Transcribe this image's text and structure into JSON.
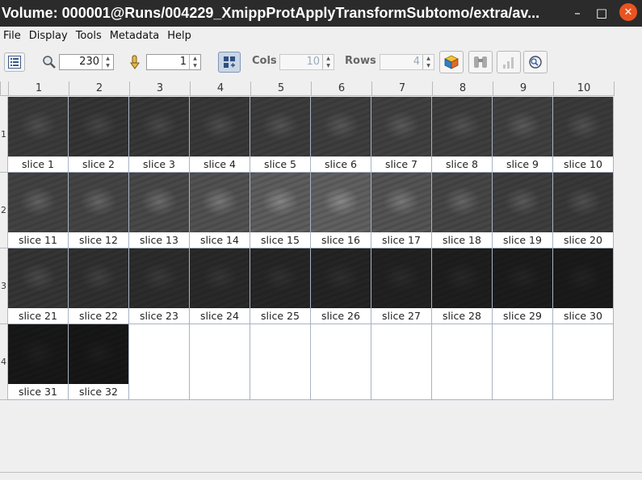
{
  "window": {
    "title": "Volume: 000001@Runs/004229_XmippProtApplyTransformSubtomo/extra/av...",
    "controls": {
      "minimize": "–",
      "maximize": "□",
      "close": "✕"
    }
  },
  "menu": [
    "File",
    "Display",
    "Tools",
    "Metadata",
    "Help"
  ],
  "toolbar": {
    "zoom_value": "230",
    "goto_value": "1",
    "cols_label": "Cols",
    "cols_value": "10",
    "rows_label": "Rows",
    "rows_value": "4",
    "icons": [
      "list-view-icon",
      "zoom-icon",
      "goto-icon",
      "grid-toggle-icon",
      "volume-3d-icon",
      "binoculars-icon",
      "histogram-icon",
      "search-icon"
    ]
  },
  "grid": {
    "column_headers": [
      "1",
      "2",
      "3",
      "4",
      "5",
      "6",
      "7",
      "8",
      "9",
      "10"
    ],
    "row_headers": [
      "1",
      "2",
      "3",
      "4"
    ],
    "slices": [
      {
        "label": "slice 1",
        "shade": "#7a7a7a",
        "hi": "#a6a6a6"
      },
      {
        "label": "slice 2",
        "shade": "#747474",
        "hi": "#9c9c9c"
      },
      {
        "label": "slice 3",
        "shade": "#767676",
        "hi": "#9e9e9e"
      },
      {
        "label": "slice 4",
        "shade": "#787878",
        "hi": "#a4a4a4"
      },
      {
        "label": "slice 5",
        "shade": "#7c7c7c",
        "hi": "#acacac"
      },
      {
        "label": "slice 6",
        "shade": "#7e7e7e",
        "hi": "#b0b0b0"
      },
      {
        "label": "slice 7",
        "shade": "#808080",
        "hi": "#b2b2b2"
      },
      {
        "label": "slice 8",
        "shade": "#7e7e7e",
        "hi": "#a8a8a8"
      },
      {
        "label": "slice 9",
        "shade": "#808080",
        "hi": "#b4b4b4"
      },
      {
        "label": "slice 10",
        "shade": "#7a7a7a",
        "hi": "#aaaaaa"
      },
      {
        "label": "slice 11",
        "shade": "#828282",
        "hi": "#c0c0c0"
      },
      {
        "label": "slice 12",
        "shade": "#848484",
        "hi": "#c4c4c4"
      },
      {
        "label": "slice 13",
        "shade": "#888888",
        "hi": "#cacaca"
      },
      {
        "label": "slice 14",
        "shade": "#909090",
        "hi": "#d4d4d4"
      },
      {
        "label": "slice 15",
        "shade": "#9a9a9a",
        "hi": "#dcdcdc"
      },
      {
        "label": "slice 16",
        "shade": "#9c9c9c",
        "hi": "#e0e0e0"
      },
      {
        "label": "slice 17",
        "shade": "#929292",
        "hi": "#d2d2d2"
      },
      {
        "label": "slice 18",
        "shade": "#868686",
        "hi": "#c2c2c2"
      },
      {
        "label": "slice 19",
        "shade": "#7e7e7e",
        "hi": "#b6b6b6"
      },
      {
        "label": "slice 20",
        "shade": "#787878",
        "hi": "#acacac"
      },
      {
        "label": "slice 21",
        "shade": "#747474",
        "hi": "#a2a2a2"
      },
      {
        "label": "slice 22",
        "shade": "#6e6e6e",
        "hi": "#969696"
      },
      {
        "label": "slice 23",
        "shade": "#6a6a6a",
        "hi": "#8c8c8c"
      },
      {
        "label": "slice 24",
        "shade": "#666666",
        "hi": "#868686"
      },
      {
        "label": "slice 25",
        "shade": "#626262",
        "hi": "#808080"
      },
      {
        "label": "slice 26",
        "shade": "#606060",
        "hi": "#7c7c7c"
      },
      {
        "label": "slice 27",
        "shade": "#5c5c5c",
        "hi": "#787878"
      },
      {
        "label": "slice 28",
        "shade": "#585858",
        "hi": "#747474"
      },
      {
        "label": "slice 29",
        "shade": "#545454",
        "hi": "#707070"
      },
      {
        "label": "slice 30",
        "shade": "#525252",
        "hi": "#6c6c6c"
      },
      {
        "label": "slice 31",
        "shade": "#4e4e4e",
        "hi": "#686868"
      },
      {
        "label": "slice 32",
        "shade": "#4c4c4c",
        "hi": "#666666"
      }
    ]
  }
}
